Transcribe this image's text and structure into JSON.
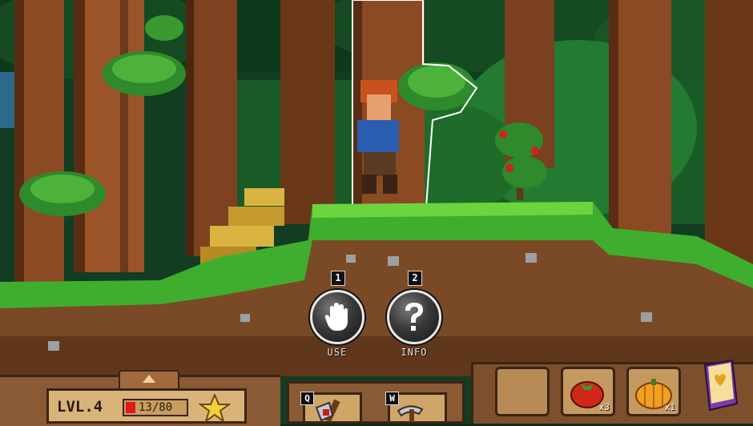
{
  "scene": {
    "colors": {
      "sky": "#2c6a8a",
      "foliage_dark": "#0e3a1c",
      "foliage_mid": "#1f6b2a",
      "trunk": "#8a4a24",
      "trunk_dark": "#5a2c14",
      "grass": "#3fae2e",
      "grass_light": "#6cd43e",
      "dirt": "#7a4a26",
      "dirt_dark": "#4e2c14",
      "gold": "#d9b440"
    }
  },
  "actions": {
    "use": {
      "key": "1",
      "label": "USE",
      "icon": "hand-icon"
    },
    "info": {
      "key": "2",
      "label": "INFO",
      "icon": "question-icon"
    }
  },
  "hud": {
    "level": "LVL.4",
    "hp_text": "13/80",
    "hp_current": 13,
    "hp_max": 80,
    "hp_color": "#e01818",
    "tools": [
      {
        "key": "Q",
        "icon": "axe-icon"
      },
      {
        "key": "W",
        "icon": "pickaxe-icon"
      }
    ],
    "inventory": [
      {
        "icon": "empty-slot",
        "count": ""
      },
      {
        "icon": "tomato-icon",
        "count": "x3"
      },
      {
        "icon": "pumpkin-icon",
        "count": "x1"
      }
    ],
    "journal_icon": "journal-icon"
  }
}
